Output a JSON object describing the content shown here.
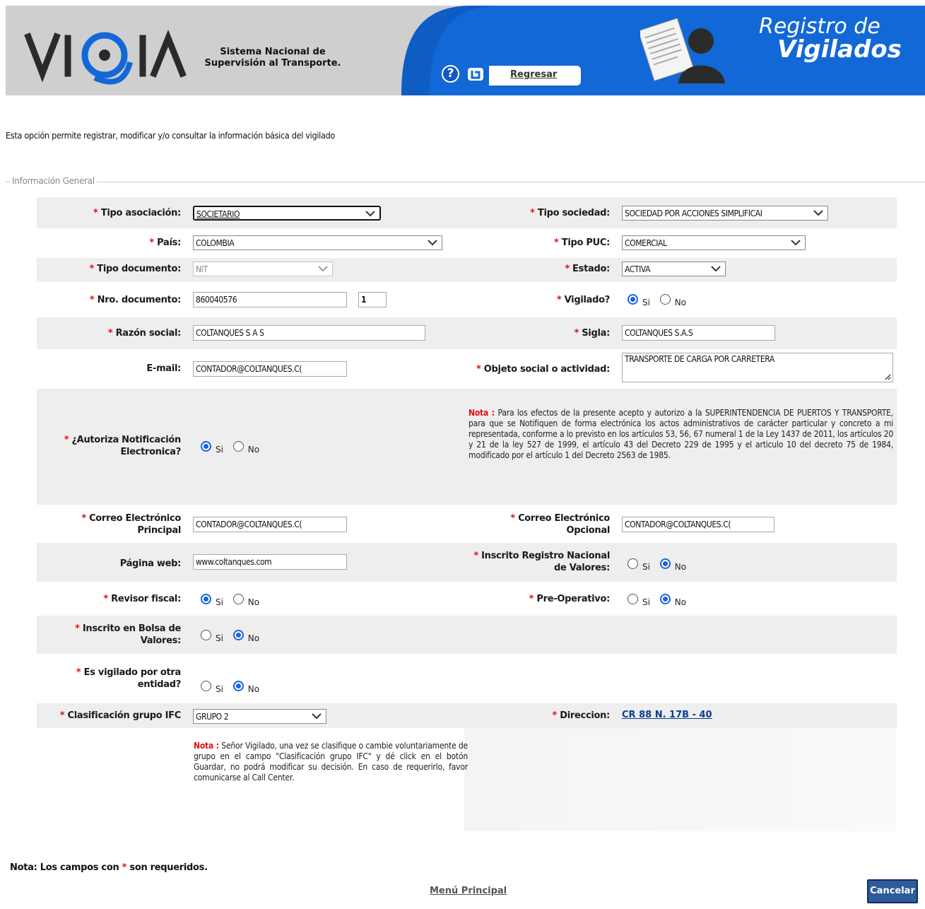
{
  "header": {
    "logo_text": "VIGIA",
    "system_name": "Sistema Nacional de Supervisión al Transporte.",
    "help_icon": "question-circle-icon",
    "return_icon": "return-arrow-icon",
    "return_label": "Regresar",
    "title_line1": "Registro de",
    "title_line2": "Vigilados"
  },
  "intro": "Esta opción permite registrar, modificar y/o consultar la información básica del vigilado",
  "fieldset_legend": "Información General",
  "required_mark": "*",
  "radio": {
    "yes": "Si",
    "no": "No"
  },
  "form": {
    "tipo_asociacion": {
      "label": "Tipo asociación:",
      "value": "SOCIETARIO"
    },
    "tipo_sociedad": {
      "label": "Tipo sociedad:",
      "value": "SOCIEDAD POR ACCIONES SIMPLIFICAI"
    },
    "pais": {
      "label": "País:",
      "value": "COLOMBIA"
    },
    "tipo_puc": {
      "label": "Tipo PUC:",
      "value": "COMERCIAL"
    },
    "tipo_documento": {
      "label": "Tipo documento:",
      "value": "NIT"
    },
    "estado": {
      "label": "Estado:",
      "value": "ACTIVA"
    },
    "nro_documento": {
      "label": "Nro. documento:",
      "value": "860040576",
      "dv": "1"
    },
    "vigilado": {
      "label": "Vigilado?",
      "selected": "Si"
    },
    "razon_social": {
      "label": "Razón social:",
      "value": "COLTANQUES S A S"
    },
    "sigla": {
      "label": "Sigla:",
      "value": "COLTANQUES S.A.S"
    },
    "email": {
      "label": "E-mail:",
      "value": "CONTADOR@COLTANQUES.C("
    },
    "objeto_social": {
      "label": "Objeto social o actividad:",
      "value": "TRANSPORTE DE CARGA POR CARRETERA"
    },
    "autoriza_notificacion": {
      "label_line1": "¿Autoriza Notificación",
      "label_line2": "Electronica?",
      "selected": "Si"
    },
    "nota_notificacion": {
      "prefix": "Nota :",
      "text": "Para los efectos de la presente acepto y autorizo a la SUPERINTENDENCIA DE PUERTOS Y TRANSPORTE, para que se Notifiquen de forma electrónica los actos administrativos de carácter particular y concreto a mi representada, conforme a lo previsto en los artículos 53, 56, 67 numeral 1 de la Ley 1437 de 2011, los artículos 20 y 21 de la ley 527 de 1999, el artículo 43 del Decreto 229 de 1995 y el articulo 10 del decreto 75 de 1984, modificado por el artículo 1 del Decreto 2563 de 1985."
    },
    "correo_principal": {
      "label_line1": "Correo Electrónico",
      "label_line2": "Principal",
      "value": "CONTADOR@COLTANQUES.C("
    },
    "correo_opcional": {
      "label_line1": "Correo Electrónico",
      "label_line2": "Opcional",
      "value": "CONTADOR@COLTANQUES.C("
    },
    "pagina_web": {
      "label": "Página web:",
      "value": "www.coltanques.com"
    },
    "registro_valores": {
      "label_line1": "Inscrito Registro Nacional",
      "label_line2": "de Valores:",
      "selected": "No"
    },
    "revisor_fiscal": {
      "label": "Revisor fiscal:",
      "selected": "Si"
    },
    "pre_operativo": {
      "label": "Pre-Operativo:",
      "selected": "No"
    },
    "bolsa_valores": {
      "label_line1": "Inscrito en Bolsa de",
      "label_line2": "Valores:",
      "selected": "No"
    },
    "otra_entidad": {
      "label_line1": "Es vigilado por otra",
      "label_line2": "entidad?",
      "selected": "No"
    },
    "grupo_ifc": {
      "label": "Clasificación grupo IFC",
      "value": "GRUPO 2"
    },
    "direccion": {
      "label": "Direccion:",
      "value": "CR 88 N. 17B - 40"
    },
    "nota_ifc": {
      "prefix": "Nota :",
      "text": "Señor Vigilado, una vez se clasifique o cambie voluntariamente de grupo en el campo \"Clasificación grupo IFC\" y dé click en el botón Guardar, no podrá modificar su decisión. En caso de requerirlo, favor comunicarse al Call Center."
    }
  },
  "footer": {
    "required_note_prefix": "Nota: Los campos con",
    "required_note_suffix": "son requeridos.",
    "menu_link": "Menú Principal",
    "cancel_button": "Cancelar"
  },
  "colors": {
    "required": "#e01010",
    "banner_blue": "#1268d6",
    "link": "#0b3d91",
    "button": "#2e5b9a"
  }
}
